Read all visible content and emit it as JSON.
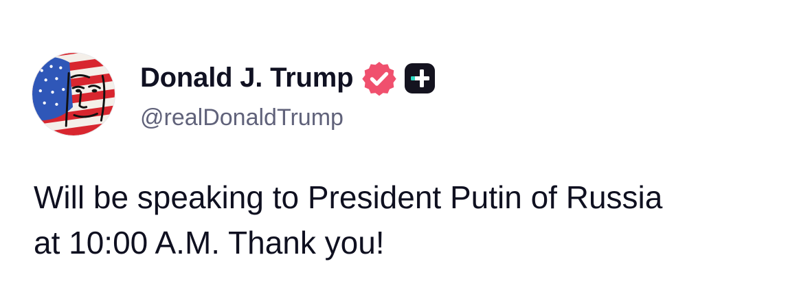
{
  "post": {
    "author": {
      "display_name": "Donald J. Trump",
      "handle": "@realDonaldTrump",
      "avatar_icon": "avatar-flag-portrait",
      "verified_icon": "verified-check-icon",
      "badge_icon": "plus-badge-icon"
    },
    "text": "Will be speaking to President Putin of Russia\nat 10:00 A.M. Thank you!"
  },
  "colors": {
    "verified_pink": "#F0506E",
    "badge_dark": "#14131F",
    "badge_teal": "#2FD9C4",
    "handle_gray": "#60627A",
    "text_dark": "#0F1020"
  }
}
